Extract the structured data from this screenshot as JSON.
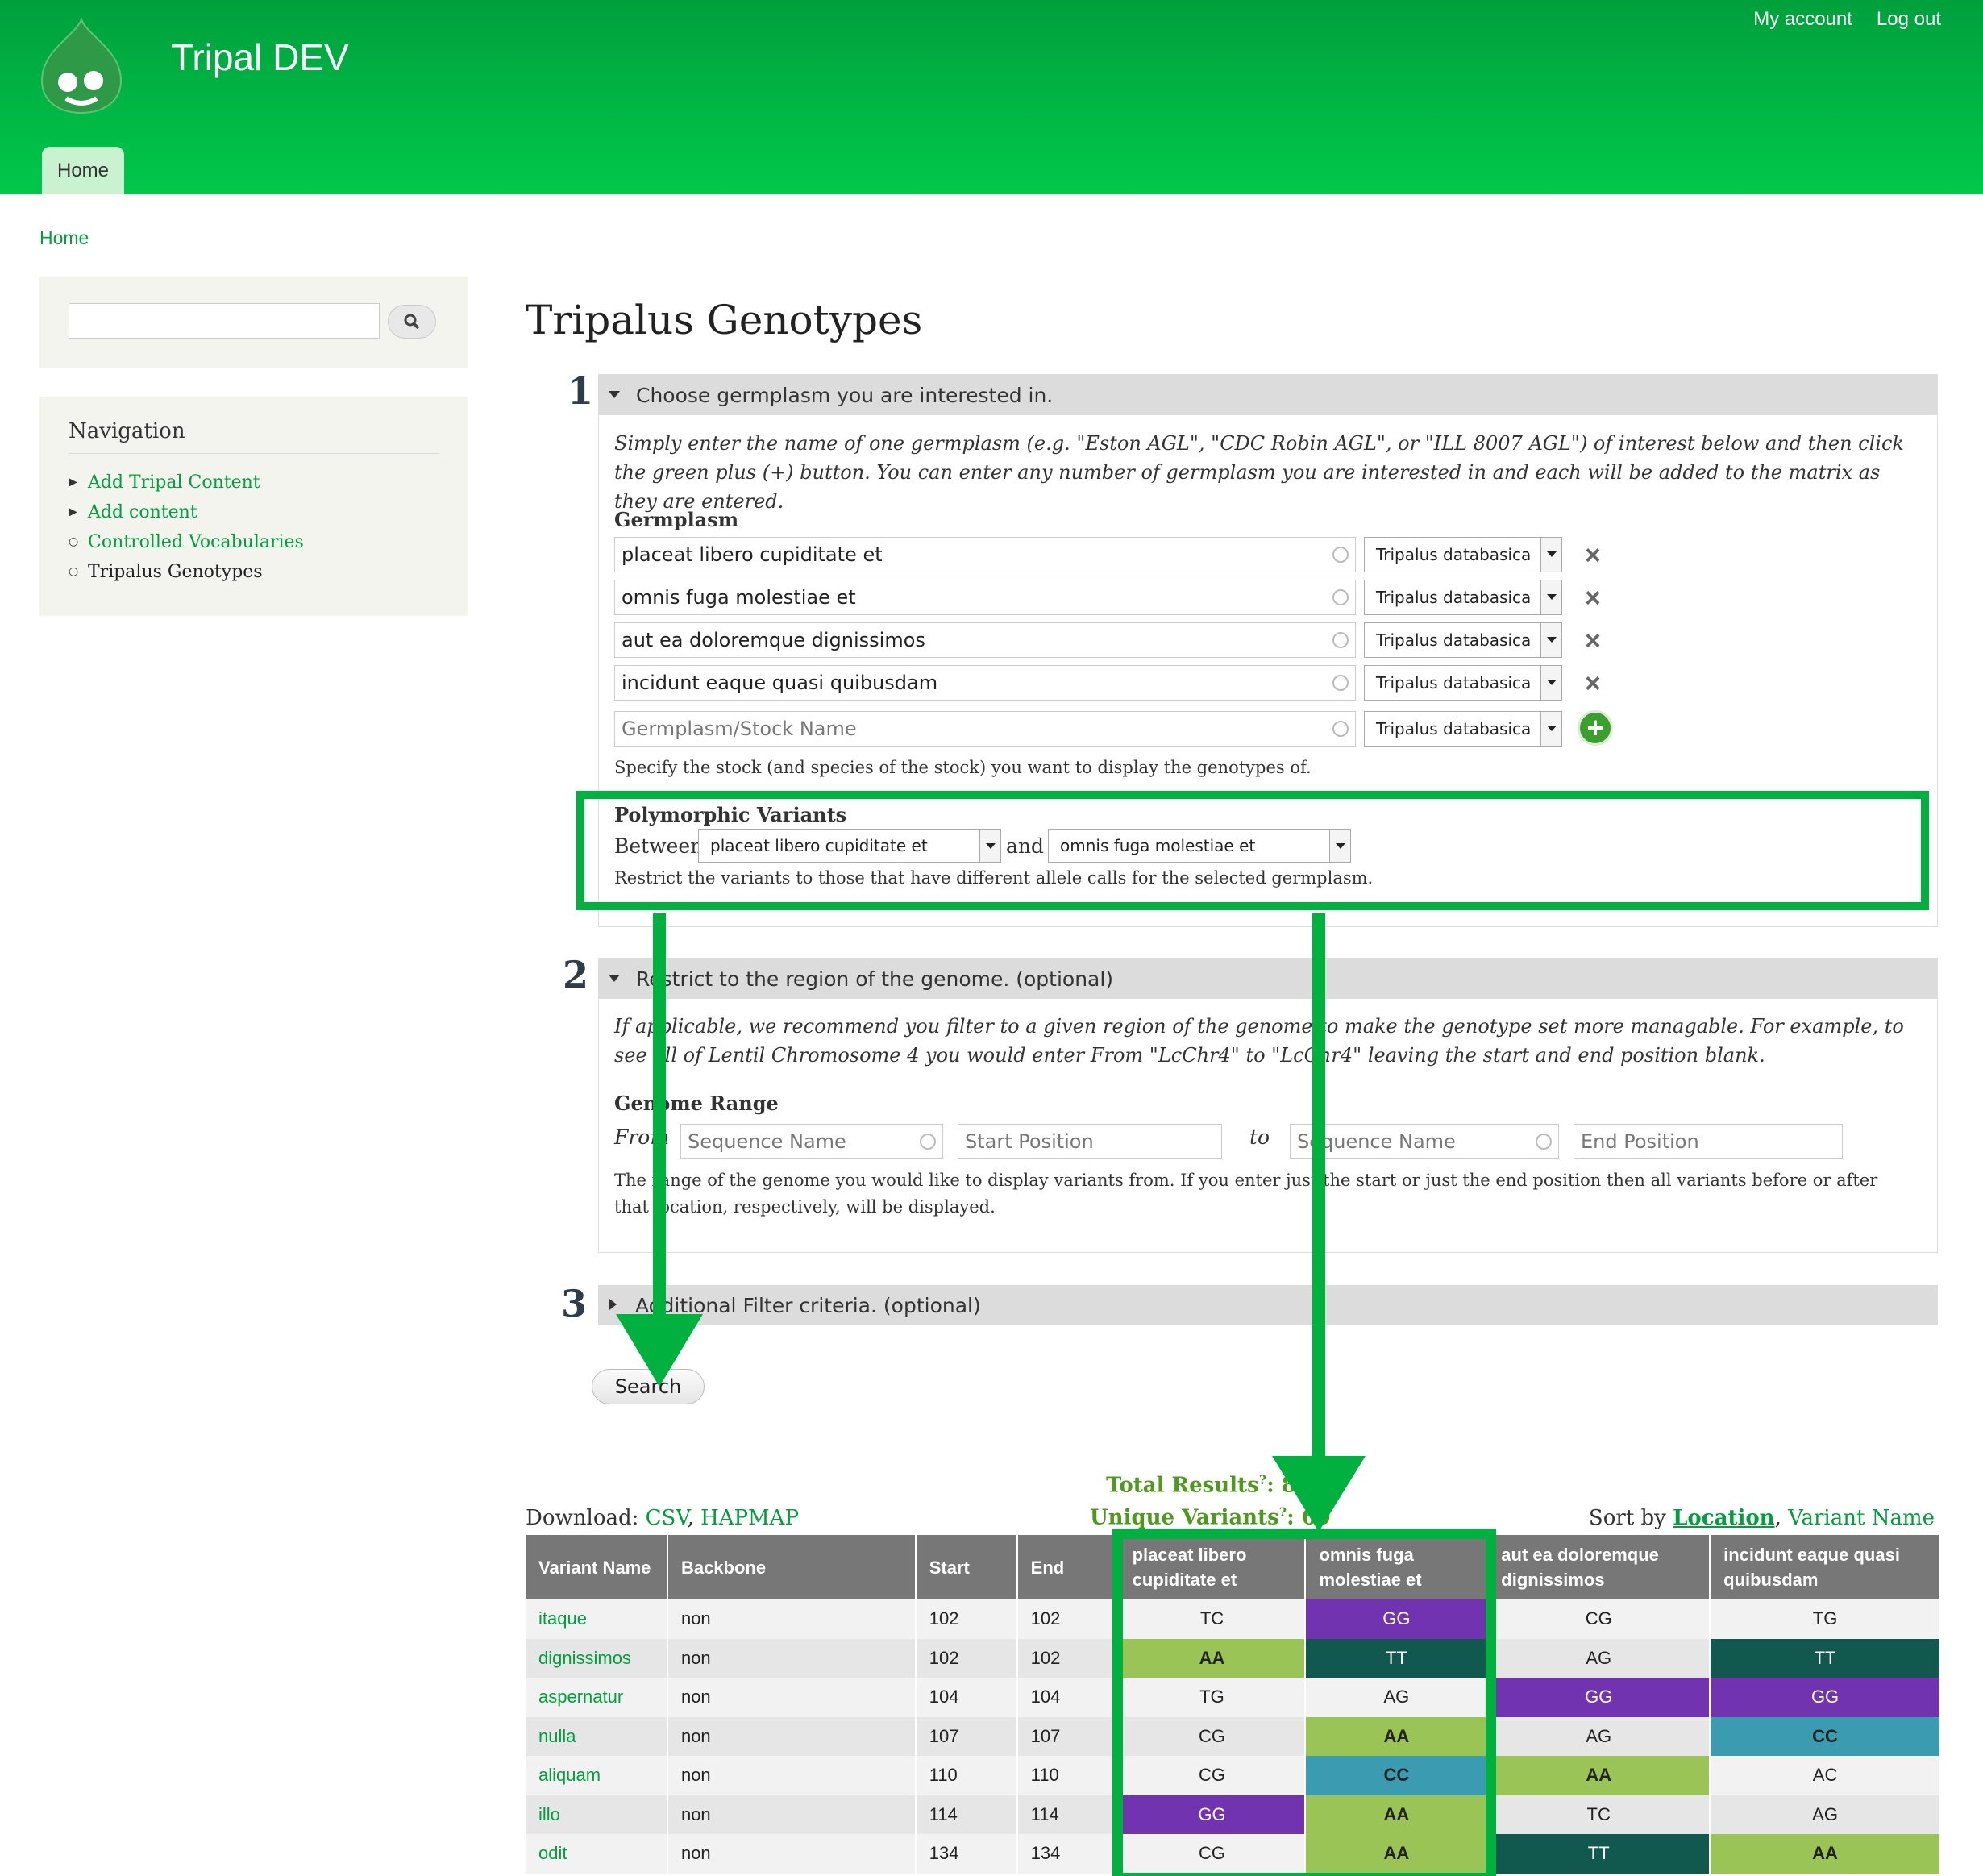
{
  "header": {
    "site_name": "Tripal DEV",
    "my_account": "My account",
    "log_out": "Log out",
    "home_tab": "Home"
  },
  "breadcrumb": "Home",
  "sidebar": {
    "nav_title": "Navigation",
    "items": [
      {
        "label": "Add Tripal Content"
      },
      {
        "label": "Add content"
      },
      {
        "label": "Controlled Vocabularies"
      },
      {
        "label": "Tripalus Genotypes"
      }
    ]
  },
  "page_title": "Tripalus Genotypes",
  "step1": {
    "num": "1",
    "legend": "Choose germplasm you are interested in.",
    "desc": "Simply enter the name of one germplasm (e.g. \"Eston AGL\", \"CDC Robin AGL\", or \"ILL 8007 AGL\") of interest below and then click the green plus (+) button. You can enter any number of germplasm you are interested in and each will be added to the matrix as they are entered.",
    "germplasm_label": "Germplasm",
    "rows": [
      {
        "name": "placeat libero cupiditate et",
        "species": "Tripalus databasica"
      },
      {
        "name": "omnis fuga molestiae et",
        "species": "Tripalus databasica"
      },
      {
        "name": "aut ea doloremque dignissimos",
        "species": "Tripalus databasica"
      },
      {
        "name": "incidunt eaque quasi quibusdam",
        "species": "Tripalus databasica"
      }
    ],
    "new_placeholder": "Germplasm/Stock Name",
    "new_species": "Tripalus databasica",
    "help": "Specify the stock (and species of the stock) you want to display the genotypes of.",
    "poly_label": "Polymorphic Variants",
    "between": "Between",
    "and": "and",
    "poly_a": "placeat libero cupiditate et",
    "poly_b": "omnis fuga molestiae et",
    "poly_help": "Restrict the variants to those that have different allele calls for the selected germplasm."
  },
  "step2": {
    "num": "2",
    "legend": "Restrict to the region of the genome. (optional)",
    "desc": "If applicable, we recommend you filter to a given region of the genome to make the genotype set more managable. For example, to see all of Lentil Chromosome 4 you would enter From \"LcChr4\" to \"LcChr4\" leaving the start and end position blank.",
    "range_label": "Genome Range",
    "from": "From",
    "to": "to",
    "seq_placeholder": "Sequence Name",
    "start_placeholder": "Start Position",
    "end_placeholder": "End Position",
    "help": "The range of the genome you would like to display variants from. If you enter just the start or just the end position then all variants before or after that location, respectively, will be displayed."
  },
  "step3": {
    "num": "3",
    "legend": "Additional Filter criteria. (optional)"
  },
  "search_button": "Search",
  "results": {
    "total_label": "Total Results",
    "total_value": "86",
    "unique_label": "Unique Variants",
    "unique_value": "69",
    "qmark": "?",
    "download_label": "Download:",
    "download_csv": "CSV",
    "download_hapmap": "HAPMAP",
    "sort_label": "Sort by",
    "sort_location": "Location",
    "sort_variant": "Variant Name",
    "columns": [
      "Variant Name",
      "Backbone",
      "Start",
      "End",
      "placeat libero cupiditate et",
      "omnis fuga molestiae et",
      "aut ea doloremque dignissimos",
      "incidunt eaque quasi quibusdam"
    ],
    "rows": [
      {
        "variant": "itaque",
        "backbone": "non",
        "start": "102",
        "end": "102",
        "calls": [
          "TC",
          "GG",
          "CG",
          "TG"
        ]
      },
      {
        "variant": "dignissimos",
        "backbone": "non",
        "start": "102",
        "end": "102",
        "calls": [
          "AA",
          "TT",
          "AG",
          "TT"
        ]
      },
      {
        "variant": "aspernatur",
        "backbone": "non",
        "start": "104",
        "end": "104",
        "calls": [
          "TG",
          "AG",
          "GG",
          "GG"
        ]
      },
      {
        "variant": "nulla",
        "backbone": "non",
        "start": "107",
        "end": "107",
        "calls": [
          "CG",
          "AA",
          "AG",
          "CC"
        ]
      },
      {
        "variant": "aliquam",
        "backbone": "non",
        "start": "110",
        "end": "110",
        "calls": [
          "CG",
          "CC",
          "AA",
          "AC"
        ]
      },
      {
        "variant": "illo",
        "backbone": "non",
        "start": "114",
        "end": "114",
        "calls": [
          "GG",
          "AA",
          "TC",
          "AG"
        ]
      },
      {
        "variant": "odit",
        "backbone": "non",
        "start": "134",
        "end": "134",
        "calls": [
          "CG",
          "AA",
          "TT",
          "AA"
        ]
      }
    ]
  },
  "colors": {
    "accent": "#00a03c",
    "highlight": "#00b140",
    "AA": "#9ac455",
    "CC": "#3b9bb0",
    "GG": "#7133b0",
    "TT": "#11584f",
    "header_bg": "#777777"
  }
}
